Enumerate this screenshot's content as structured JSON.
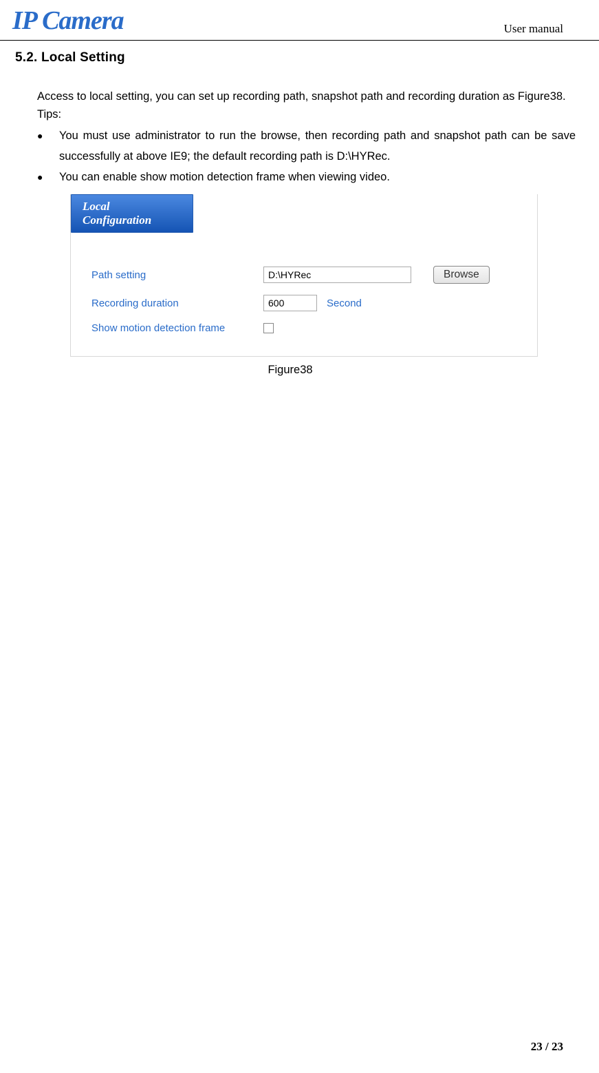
{
  "header": {
    "logo": "IP Camera",
    "doc_title": "User manual"
  },
  "section": {
    "heading": "5.2. Local Setting",
    "intro": "Access to local setting, you can set up recording path, snapshot path and recording duration as Figure38.",
    "tips_label": "Tips:",
    "bullets": [
      "You must use administrator to run the browse, then recording path and snapshot path can be save successfully at above IE9; the default recording path is D:\\HYRec.",
      "You can enable show motion detection frame when viewing video."
    ]
  },
  "figure": {
    "panel_title": "Local Configuration",
    "rows": {
      "path": {
        "label": "Path setting",
        "value": "D:\\HYRec",
        "browse": "Browse"
      },
      "duration": {
        "label": "Recording duration",
        "value": "600",
        "unit": "Second"
      },
      "motion": {
        "label": "Show motion detection frame"
      }
    },
    "caption": "Figure38"
  },
  "footer": {
    "page": "23 / 23"
  }
}
